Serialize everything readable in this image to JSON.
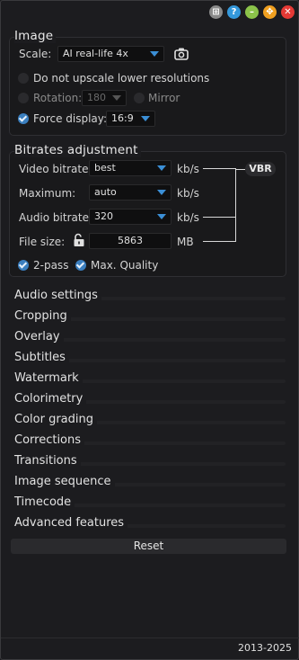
{
  "window_buttons": [
    {
      "name": "screenshot",
      "glyph": "⊞"
    },
    {
      "name": "help",
      "glyph": "?"
    },
    {
      "name": "minimize",
      "glyph": "–"
    },
    {
      "name": "maximize",
      "glyph": "✥"
    },
    {
      "name": "close",
      "glyph": "✕"
    }
  ],
  "image": {
    "title": "Image",
    "scale_label": "Scale:",
    "scale_value": "AI real-life 4x",
    "no_upscale_label": "Do not upscale lower resolutions",
    "no_upscale_checked": false,
    "rotation_label": "Rotation:",
    "rotation_value": "180",
    "rotation_checked": false,
    "mirror_label": "Mirror",
    "mirror_checked": false,
    "force_display_label": "Force display:",
    "force_display_value": "16:9",
    "force_display_checked": true
  },
  "bitrates": {
    "title": "Bitrates adjustment",
    "video_label": "Video bitrate:",
    "video_value": "best",
    "video_unit": "kb/s",
    "maximum_label": "Maximum:",
    "maximum_value": "auto",
    "maximum_unit": "kb/s",
    "audio_label": "Audio bitrate:",
    "audio_value": "320",
    "audio_unit": "kb/s",
    "filesize_label": "File size:",
    "filesize_value": "5863",
    "filesize_unit": "MB",
    "vbr_label": "VBR",
    "twopass_label": "2-pass",
    "twopass_checked": true,
    "maxquality_label": "Max. Quality",
    "maxquality_checked": true
  },
  "sections": [
    "Audio settings",
    "Cropping",
    "Overlay",
    "Subtitles",
    "Watermark",
    "Colorimetry",
    "Color grading",
    "Corrections",
    "Transitions",
    "Image sequence",
    "Timecode",
    "Advanced features"
  ],
  "reset_label": "Reset",
  "footer_text": "2013-2025",
  "colors": {
    "accent": "#3b7fbf",
    "arrow": "#3b8fd6",
    "background": "#1c1c1f"
  }
}
